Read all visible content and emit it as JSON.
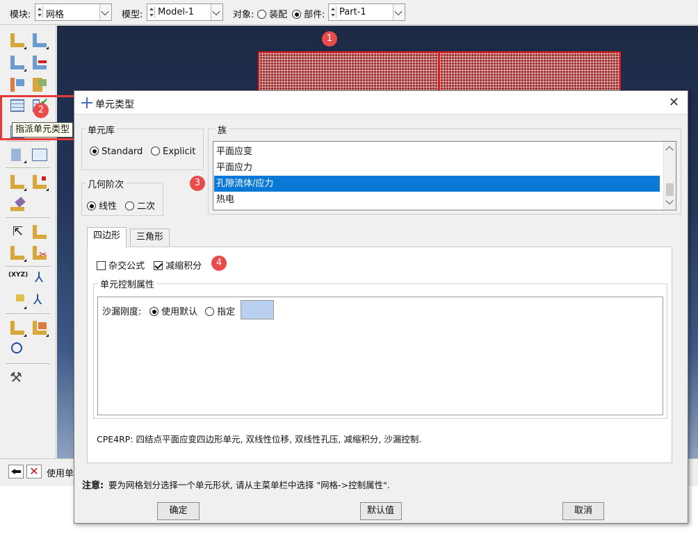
{
  "topbar": {
    "module_label": "模块:",
    "module_value": "网格",
    "model_label": "模型:",
    "model_value": "Model-1",
    "object_label": "对象:",
    "assembly_option": "装配",
    "part_option": "部件:",
    "part_value": "Part-1",
    "selected_object": "part"
  },
  "callouts": [
    "1",
    "2",
    "3",
    "4"
  ],
  "tooltip": "指派单元类型",
  "prompt": {
    "text": "使用单"
  },
  "dialog": {
    "title": "单元类型",
    "library": {
      "title": "单元库",
      "options": [
        "Standard",
        "Explicit"
      ],
      "selected": "Standard"
    },
    "order": {
      "title": "几何阶次",
      "options": [
        "线性",
        "二次"
      ],
      "selected": "线性"
    },
    "family": {
      "title": "族",
      "items": [
        "平面应变",
        "平面应力",
        "孔隙流体/应力",
        "热电"
      ],
      "selected": "孔隙流体/应力"
    },
    "tabs": [
      "四边形",
      "三角形"
    ],
    "active_tab": "四边形",
    "hybrid": {
      "label": "杂交公式",
      "checked": false
    },
    "reduced": {
      "label": "减缩积分",
      "checked": true
    },
    "control": {
      "title": "单元控制属性",
      "hourglass_label": "沙漏刚度:",
      "option_default": "使用默认",
      "option_specify": "指定",
      "selected": "使用默认"
    },
    "description": "CPE4RP:  四结点平面应变四边形单元, 双线性位移, 双线性孔压, 减缩积分, 沙漏控制.",
    "note_label": "注意:",
    "note_text": "要为网格划分选择一个单元形状, 请从主菜单栏中选择 \"网格->控制属性\".",
    "buttons": {
      "ok": "确定",
      "defaults": "默认值",
      "cancel": "取消"
    }
  },
  "colors": {
    "selection": "#0a78d7",
    "callout": "#e94b4b",
    "mesh": "#a23434"
  }
}
